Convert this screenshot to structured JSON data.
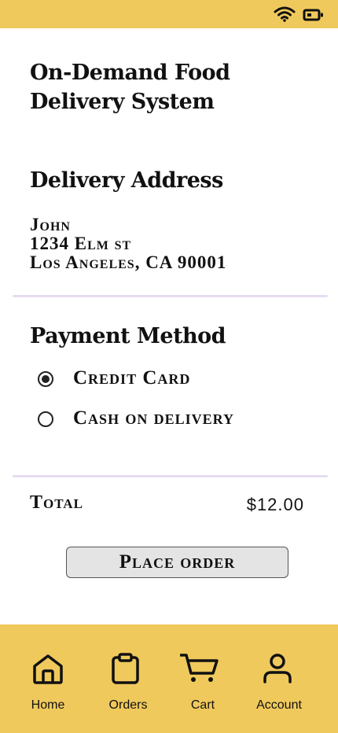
{
  "status_bar": {
    "wifi_icon": "wifi-icon",
    "battery_icon": "battery-icon"
  },
  "app": {
    "title_line1": "On-Demand Food",
    "title_line2": "Delivery System"
  },
  "delivery": {
    "heading": "Delivery Address",
    "name": "John",
    "street": "1234 Elm st",
    "city": "Los Angeles, CA 90001"
  },
  "payment": {
    "heading": "Payment Method",
    "options": [
      {
        "label": "Credit Card",
        "selected": true
      },
      {
        "label": "Cash on delivery",
        "selected": false
      }
    ]
  },
  "order": {
    "total_label": "Total",
    "total_value": "$12.00",
    "place_order_label": "Place order"
  },
  "nav": {
    "items": [
      {
        "label": "Home",
        "icon": "home-icon"
      },
      {
        "label": "Orders",
        "icon": "clipboard-icon"
      },
      {
        "label": "Cart",
        "icon": "cart-icon"
      },
      {
        "label": "Account",
        "icon": "user-icon"
      }
    ]
  },
  "colors": {
    "accent": "#f0c95c",
    "divider": "#e6dcf0",
    "button_bg": "#e4e4e4"
  }
}
